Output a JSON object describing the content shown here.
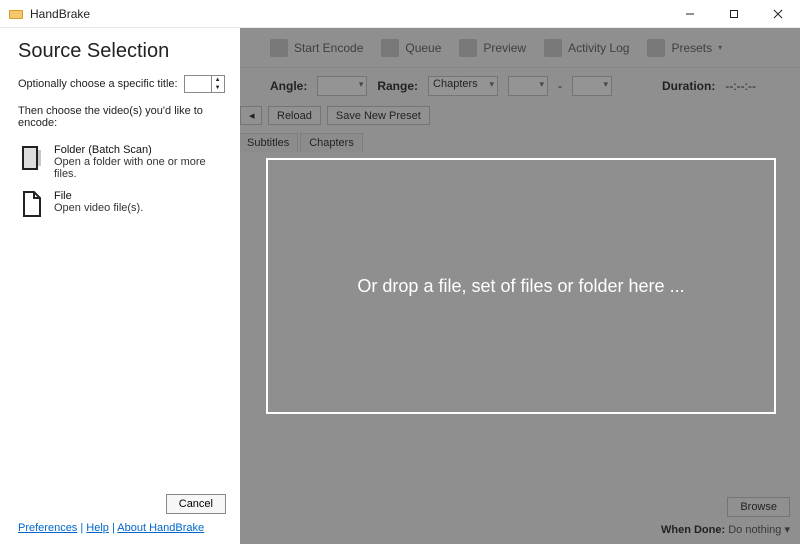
{
  "window": {
    "title": "HandBrake",
    "minimize": "min",
    "maximize": "max",
    "close": "close"
  },
  "toolbar": {
    "start_encode": "Start Encode",
    "queue": "Queue",
    "preview": "Preview",
    "activity_log": "Activity Log",
    "presets": "Presets"
  },
  "source": {
    "angle_label": "Angle:",
    "range_label": "Range:",
    "range_value": "Chapters",
    "dash": "-",
    "duration_label": "Duration:",
    "duration_value": "--:--:--",
    "reload_btn": "Reload",
    "save_preset_btn": "Save New Preset",
    "tab_subtitles": "Subtitles",
    "tab_chapters": "Chapters"
  },
  "bottom": {
    "browse": "Browse",
    "when_done_label": "When Done:",
    "when_done_value": "Do nothing"
  },
  "panel": {
    "heading": "Source Selection",
    "opt_title_label": "Optionally choose a specific title:",
    "instruction": "Then choose the video(s) you'd like to encode:",
    "folder": {
      "title": "Folder (Batch Scan)",
      "sub": "Open a folder with one or more files."
    },
    "file": {
      "title": "File",
      "sub": "Open video file(s)."
    },
    "cancel": "Cancel",
    "links": {
      "preferences": "Preferences",
      "help": "Help",
      "about": "About HandBrake",
      "sep": " | "
    }
  },
  "dropzone": {
    "text": "Or drop a file, set of files or folder here ..."
  }
}
